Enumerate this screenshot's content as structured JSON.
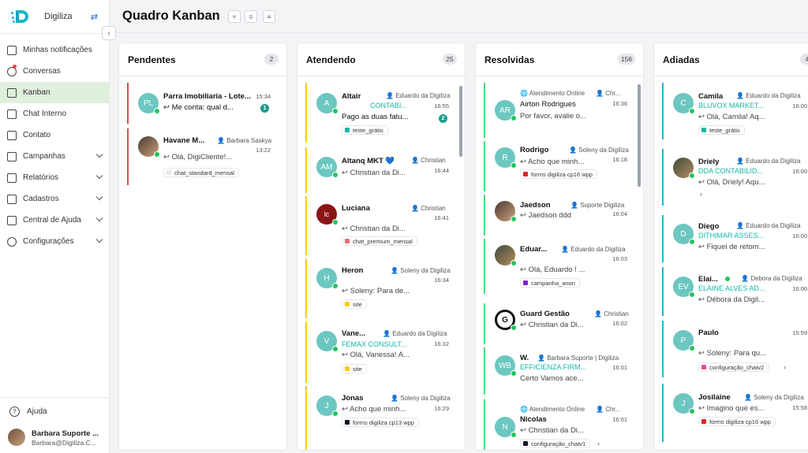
{
  "brand": {
    "name": "Digiliza",
    "switch_icon": "switch-arrows-icon"
  },
  "sidebar": {
    "items": [
      {
        "label": "Minhas notificações",
        "icon": "inbox-icon"
      },
      {
        "label": "Conversas",
        "icon": "chat-bubble-icon"
      },
      {
        "label": "Kanban",
        "icon": "kanban-grid-icon"
      },
      {
        "label": "Chat Interno",
        "icon": "chat-internal-icon"
      },
      {
        "label": "Contato",
        "icon": "contact-card-icon"
      },
      {
        "label": "Campanhas",
        "icon": "megaphone-icon"
      },
      {
        "label": "Relatórios",
        "icon": "chart-icon"
      },
      {
        "label": "Cadastros",
        "icon": "register-icon"
      },
      {
        "label": "Central de Ajuda",
        "icon": "books-icon"
      },
      {
        "label": "Configurações",
        "icon": "gear-icon"
      }
    ],
    "help": "Ajuda",
    "user": {
      "name": "Barbara Suporte ...",
      "email": "Barbara@Digiliza.C..."
    }
  },
  "header": {
    "title": "Quadro Kanban"
  },
  "colors": {
    "accent": "#14b8a6",
    "active_nav": "#dff0dc",
    "pendentes": "#ef4444",
    "atendendo": "#facc15",
    "resolvidas": "#4ade80",
    "adiadas": "#22b8cf"
  },
  "columns": [
    {
      "title": "Pendentes",
      "count": "2",
      "cards": [
        {
          "initials": "PL",
          "name": "Parra Imobiliaria - Lote...",
          "time": "15:34",
          "message": "Me conta: qual d...",
          "badge": "1"
        },
        {
          "initials": "",
          "name": "Havane M...",
          "agent": "Barbara Saskya",
          "time": "13:22",
          "message": "Olá, DigiCliente!...",
          "tag": "chat_standard_mensal"
        }
      ]
    },
    {
      "title": "Atendendo",
      "count": "25",
      "cards": [
        {
          "initials": "A",
          "name": "Altair",
          "agent": "Eduardo da Digiliza",
          "company": "CONTABI...",
          "time": "16:55",
          "message": "Pago as duas fatu...",
          "badge": "2",
          "tag": "teste_grátis"
        },
        {
          "initials": "AM",
          "name": "Altanq MKT 💙",
          "agent": "Christian",
          "time": "16:44",
          "message": "Christian da Di..."
        },
        {
          "initials": "lc",
          "name": "Luciana",
          "agent": "Christian",
          "time": "16:41",
          "message": "Christian da Di...",
          "tag": "chat_premium_mensal"
        },
        {
          "initials": "H",
          "name": "Heron",
          "agent": "Soleny da Digiliza",
          "time": "16:34",
          "message": "Soleny: Para de...",
          "tag": "site"
        },
        {
          "initials": "V",
          "name": "Vane...",
          "agent": "Eduardo da Digiliza",
          "company": "FEMAX CONSULT...",
          "time": "16:32",
          "message": "Olá, Vanessa! A...",
          "tag": "site"
        },
        {
          "initials": "J",
          "name": "Jonas",
          "agent": "Soleny da Digiliza",
          "time": "16:29",
          "message": "Acho que minh...",
          "tag": "forms digiliza cp13 wpp"
        }
      ]
    },
    {
      "title": "Resolvidas",
      "count": "156",
      "cards": [
        {
          "initials": "AR",
          "pre": "Atendimento Online",
          "agent": "Chr...",
          "name": "Airton Rodrigues",
          "time": "16:36",
          "message": "Por favor, avalie o..."
        },
        {
          "initials": "R",
          "name": "Rodrigo",
          "agent": "Soleny da Digiliza",
          "time": "16:18",
          "message": "Acho que minh...",
          "tag": "forms digiliza cp16 wpp"
        },
        {
          "initials": "",
          "name": "Jaedson",
          "agent": "Suporte Digiliza",
          "time": "16:04",
          "message": "Jaedson ddd"
        },
        {
          "initials": "",
          "name": "Eduar...",
          "agent": "Eduardo da Digiliza",
          "time": "16:03",
          "message": "Olá, Eduardo ! ...",
          "tag": "campanha_anon"
        },
        {
          "initials": "G",
          "name": "Guard Gestão",
          "agent": "Christian",
          "time": "16:02",
          "message": "Christian da Di..."
        },
        {
          "initials": "WB",
          "name": "W.",
          "agent": "Barbara Suporte | Digiliza",
          "company": "EFFICIENZA FIRM...",
          "time": "16:01",
          "message": "Certo Vamos ace..."
        },
        {
          "initials": "N",
          "pre": "Atendimento Online",
          "agent": "Chr...",
          "name": "Nicolas",
          "time": "16:01",
          "message": "Christian da Di...",
          "tag": "configuração_chatv1"
        }
      ]
    },
    {
      "title": "Adiadas",
      "count": "4",
      "cards": [
        {
          "initials": "C",
          "name": "Camila",
          "agent": "Eduardo da Digiliza",
          "company": "BLUVOX MARKET...",
          "time": "16:00",
          "message": "Olá, Camila! Aq...",
          "tag": "teste_grátis"
        },
        {
          "initials": "",
          "name": "Driely",
          "agent": "Eduardo da Digiliza",
          "company": "DDA CONTABILID...",
          "time": "16:00",
          "message": "Olá, Driely! Aqu..."
        },
        {
          "initials": "D",
          "name": "Diego",
          "agent": "Eduardo da Digiliza",
          "company": "DITHIMAR ASSES...",
          "time": "16:00",
          "message": "Fiquei de retom..."
        },
        {
          "initials": "EV",
          "name": "Elai...",
          "agent": "Debora da Digiliza",
          "company": "ELAINE ALVES AD...",
          "time": "16:00",
          "message": "Débora da Digil..."
        },
        {
          "initials": "P",
          "name": "Paulo",
          "time": "15:59",
          "message": "Soleny: Para qu...",
          "tag": "configuração_chatv2"
        },
        {
          "initials": "J",
          "name": "Josilaine",
          "agent": "Soleny da Digiliza",
          "time": "15:58",
          "message": "Imagino que es...",
          "tag": "forms digiliza cp16 wpp"
        }
      ]
    }
  ]
}
